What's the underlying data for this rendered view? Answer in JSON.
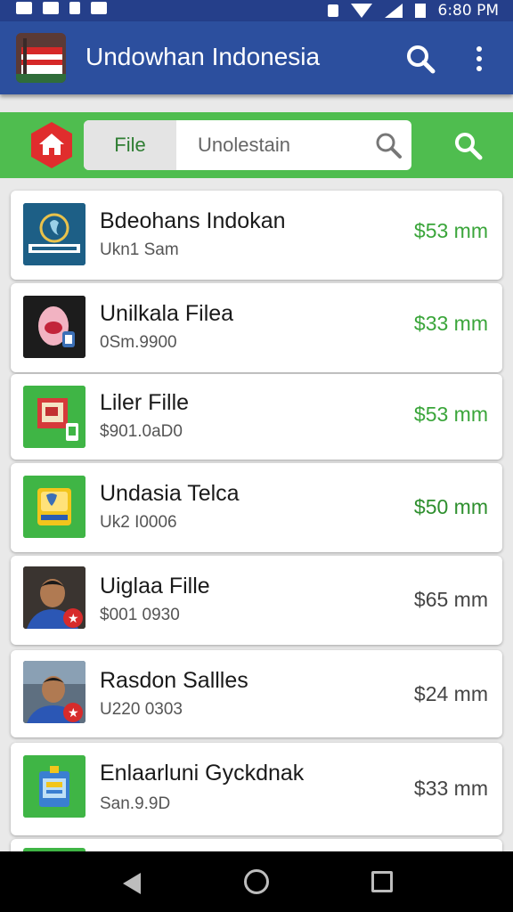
{
  "status_bar": {
    "time": "6:80 PM",
    "icons": [
      "notification-icon",
      "mail-icon",
      "edit-icon",
      "gallery-icon",
      "bluetooth-icon",
      "wifi-icon",
      "signal-icon",
      "battery-icon"
    ]
  },
  "app_bar": {
    "title": "Undowhan Indonesia",
    "logo": "flag-logo",
    "color": "#2c4f9e"
  },
  "search_bar": {
    "file_tab_label": "File",
    "placeholder": "Unolestain",
    "color": "#4fbd4f"
  },
  "items": [
    {
      "title": "Bdeohans Indokan",
      "subtitle": "Ukn1 Sam",
      "price": "$53 mm",
      "price_color": "#3aa53a",
      "thumb": "app-logo-thumb"
    },
    {
      "title": "Unilkala Filea",
      "subtitle": "0Sm.9900",
      "price": "$33 mm",
      "price_color": "#3aa53a",
      "thumb": "portrait-thumb"
    },
    {
      "title": "Liler Fille",
      "subtitle": "$901.0aD0",
      "price": "$53 mm",
      "price_color": "#3aa53a",
      "thumb": "document-thumb"
    },
    {
      "title": "Undasia Telca",
      "subtitle": "Uk2 I0006",
      "price": "$50 mm",
      "price_color": "#2e8f2e",
      "thumb": "card-thumb"
    },
    {
      "title": "Uiglaa Fille",
      "subtitle": "$001 0930",
      "price": "$65 mm",
      "price_color": "#444444",
      "thumb": "person-thumb"
    },
    {
      "title": "Rasdon Sallles",
      "subtitle": "U220 0303",
      "price": "$24 mm",
      "price_color": "#444444",
      "thumb": "person-thumb-2"
    },
    {
      "title": "Enlaarluni Gyckdnak",
      "subtitle": "San.9.9D",
      "price": "$33 mm",
      "price_color": "#444444",
      "thumb": "badge-thumb"
    }
  ],
  "nav_bar": {
    "buttons": [
      "back-icon",
      "home-icon",
      "recents-icon"
    ]
  }
}
